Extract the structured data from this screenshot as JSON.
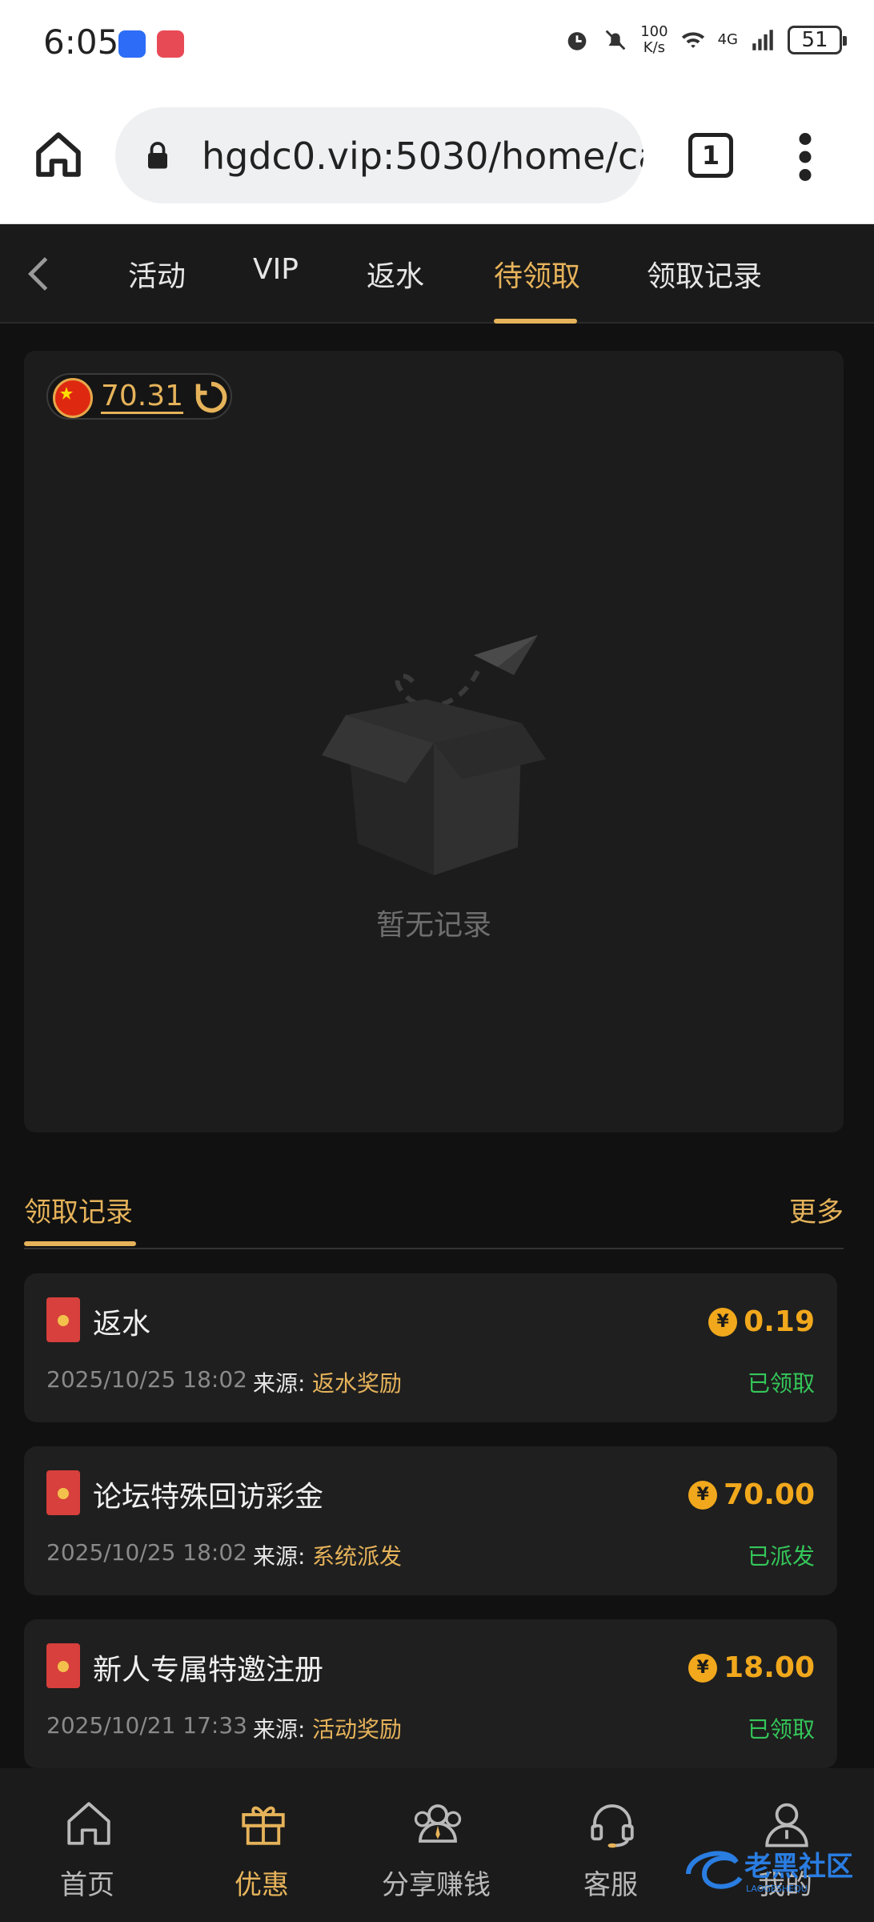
{
  "status_bar": {
    "time": "6:05",
    "net_speed_value": "100",
    "net_speed_unit": "K/s",
    "network_label": "4G",
    "battery": "51"
  },
  "browser": {
    "url": "hgdc0.vip:5030/home/ca",
    "tab_count": "1"
  },
  "top_nav": {
    "tabs": [
      {
        "label": "活动"
      },
      {
        "label": "VIP"
      },
      {
        "label": "返水"
      },
      {
        "label": "待领取",
        "active": true
      },
      {
        "label": "领取记录"
      }
    ]
  },
  "wallet": {
    "balance": "70.31"
  },
  "empty_state": {
    "text": "暂无记录"
  },
  "records": {
    "title": "领取记录",
    "more": "更多",
    "source_label": "来源:",
    "items": [
      {
        "title": "返水",
        "amount": "0.19",
        "date": "2025/10/25 18:02",
        "source": "返水奖励",
        "status": "已领取"
      },
      {
        "title": "论坛特殊回访彩金",
        "amount": "70.00",
        "date": "2025/10/25 18:02",
        "source": "系统派发",
        "status": "已派发"
      },
      {
        "title": "新人专属特邀注册",
        "amount": "18.00",
        "date": "2025/10/21 17:33",
        "source": "活动奖励",
        "status": "已领取"
      }
    ]
  },
  "bottom_nav": {
    "items": [
      {
        "label": "首页",
        "icon": "home-icon"
      },
      {
        "label": "优惠",
        "icon": "gift-icon",
        "active": true
      },
      {
        "label": "分享赚钱",
        "icon": "share-earn-icon"
      },
      {
        "label": "客服",
        "icon": "headset-icon"
      },
      {
        "label": "我的",
        "icon": "profile-icon"
      }
    ]
  },
  "watermark": {
    "text": "老黑社区",
    "sub": "LAOGESHEQU"
  },
  "colors": {
    "accent": "#e6b35a",
    "amount": "#f1a81c",
    "success": "#34c759",
    "background": "#111111",
    "card": "#1c1c1c"
  }
}
